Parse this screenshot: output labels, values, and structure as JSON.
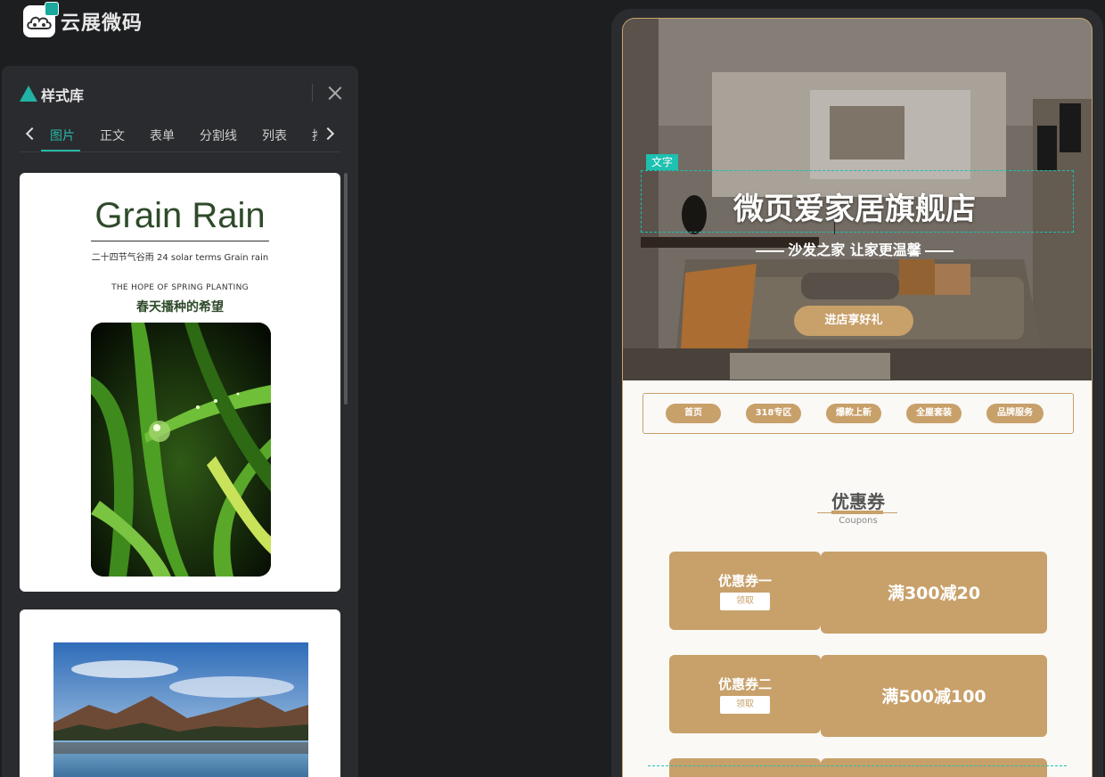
{
  "app": {
    "brand_name": "云展微码"
  },
  "panel": {
    "title": "样式库",
    "tabs": [
      {
        "label": "图片",
        "active": true
      },
      {
        "label": "正文"
      },
      {
        "label": "表单"
      },
      {
        "label": "分割线"
      },
      {
        "label": "列表"
      },
      {
        "label": "按"
      }
    ],
    "cards": [
      {
        "title": "Grain Rain",
        "subtitle": "二十四节气谷雨 24   solar terms Grain rain",
        "tagline_en": "THE HOPE OF SPRING PLANTING",
        "tagline_cn": "春天播种的希望",
        "image": "grass-dewdrop"
      },
      {
        "image": "mountain-lake"
      }
    ]
  },
  "preview": {
    "hero": {
      "title": "微页爱家居旗舰店",
      "subtitle": "沙发之家 让家更温馨",
      "button": "进店享好礼",
      "selection_tag": "文字"
    },
    "nav": [
      "首页",
      "318专区",
      "爆款上新",
      "全屋套装",
      "品牌服务"
    ],
    "coupon_section": {
      "title": "优惠券",
      "subtitle": "Coupons"
    },
    "coupons": [
      {
        "name": "优惠券一",
        "action": "领取",
        "amount": "满300减20"
      },
      {
        "name": "优惠券二",
        "action": "领取",
        "amount": "满500减100"
      }
    ]
  },
  "colors": {
    "accent": "#27b8a8",
    "gold": "#c8a06a",
    "background": "#1d1e20"
  }
}
